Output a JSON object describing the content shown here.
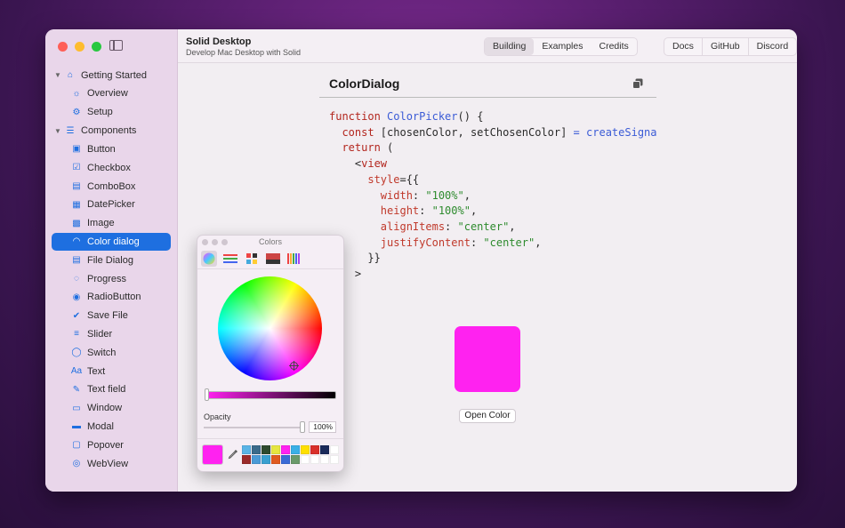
{
  "window": {
    "app_title": "Solid Desktop",
    "app_subtitle": "Develop Mac Desktop with Solid"
  },
  "toolbar": {
    "tabs": [
      "Building",
      "Examples",
      "Credits"
    ],
    "active_tab": "Building",
    "links": [
      "Docs",
      "GitHub",
      "Discord"
    ]
  },
  "sidebar": {
    "groups": [
      {
        "label": "Getting Started",
        "icon": "home-icon",
        "items": [
          {
            "label": "Overview",
            "icon": "lightbulb-icon"
          },
          {
            "label": "Setup",
            "icon": "gears-icon"
          }
        ]
      },
      {
        "label": "Components",
        "icon": "list-icon",
        "items": [
          {
            "label": "Button",
            "icon": "button-icon"
          },
          {
            "label": "Checkbox",
            "icon": "checkbox-icon"
          },
          {
            "label": "ComboBox",
            "icon": "combobox-icon"
          },
          {
            "label": "DatePicker",
            "icon": "calendar-icon"
          },
          {
            "label": "Image",
            "icon": "image-icon"
          },
          {
            "label": "Color dialog",
            "icon": "rainbow-icon"
          },
          {
            "label": "File Dialog",
            "icon": "file-dialog-icon"
          },
          {
            "label": "Progress",
            "icon": "progress-icon"
          },
          {
            "label": "RadioButton",
            "icon": "radio-icon"
          },
          {
            "label": "Save File",
            "icon": "check-circle-icon"
          },
          {
            "label": "Slider",
            "icon": "slider-icon"
          },
          {
            "label": "Switch",
            "icon": "switch-icon"
          },
          {
            "label": "Text",
            "icon": "text-icon"
          },
          {
            "label": "Text field",
            "icon": "textfield-icon"
          },
          {
            "label": "Window",
            "icon": "window-icon"
          },
          {
            "label": "Modal",
            "icon": "modal-icon"
          },
          {
            "label": "Popover",
            "icon": "popover-icon"
          },
          {
            "label": "WebView",
            "icon": "globe-icon"
          }
        ]
      }
    ],
    "selected": "Color dialog"
  },
  "main": {
    "title": "ColorDialog",
    "code_lines": [
      "function ColorPicker() {",
      "  const [chosenColor, setChosenColor] = createSignal",
      "  return (",
      "    <view",
      "      style={{",
      "        width: \"100%\",",
      "        height: \"100%\",",
      "        alignItems: \"center\",",
      "        justifyContent: \"center\",",
      "      }}",
      "    >"
    ],
    "swatch_color": "#ff22f0",
    "button_label": "Open Color"
  },
  "color_panel": {
    "title": "Colors",
    "opacity_label": "Opacity",
    "opacity_value": "100%",
    "opacity_fraction": 1.0,
    "brightness_fraction": 0.0,
    "current_color": "#ff22f0",
    "swatches": [
      "#5ab4e6",
      "#3a6a8a",
      "#2e4a2e",
      "#e6e640",
      "#ff22f0",
      "#3ab0e6",
      "#ffe000",
      "#d9302a",
      "#1a2a5a",
      "#ffffff",
      "#9a2a2a",
      "#4a9ad6",
      "#3aa0d0",
      "#e05a20",
      "#3a6ad6",
      "#6a9a6a",
      "#ffffff",
      "#ffffff",
      "#ffffff",
      "#ffffff"
    ]
  }
}
